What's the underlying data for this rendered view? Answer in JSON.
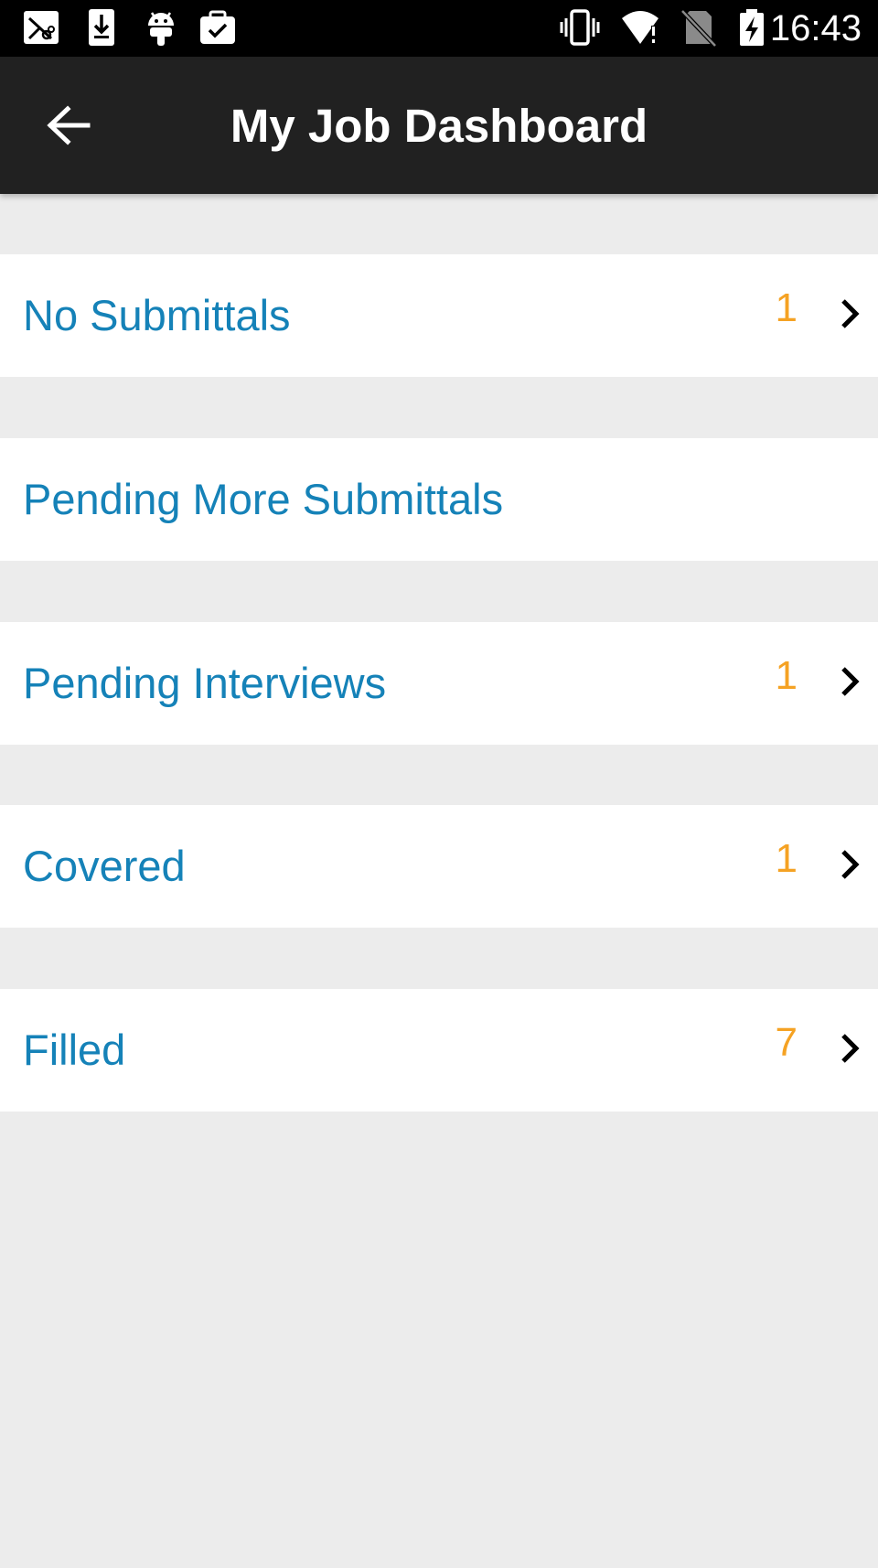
{
  "status_bar": {
    "time": "16:43",
    "icons": [
      "scissors-icon",
      "download-icon",
      "android-icon",
      "briefcase-check-icon",
      "vibrate-icon",
      "wifi-alert-icon",
      "no-sim-icon",
      "battery-charging-icon"
    ]
  },
  "app_bar": {
    "title": "My Job Dashboard",
    "back_icon": "arrow-left-icon"
  },
  "rows": [
    {
      "label": "No Submittals",
      "count": "1"
    },
    {
      "label": "Pending More Submittals",
      "count": ""
    },
    {
      "label": "Pending Interviews",
      "count": "1"
    },
    {
      "label": "Covered",
      "count": "1"
    },
    {
      "label": "Filled",
      "count": "7"
    }
  ],
  "colors": {
    "label": "#1582b8",
    "count": "#f5a223",
    "app_bar": "#212121",
    "background": "#ececec"
  }
}
